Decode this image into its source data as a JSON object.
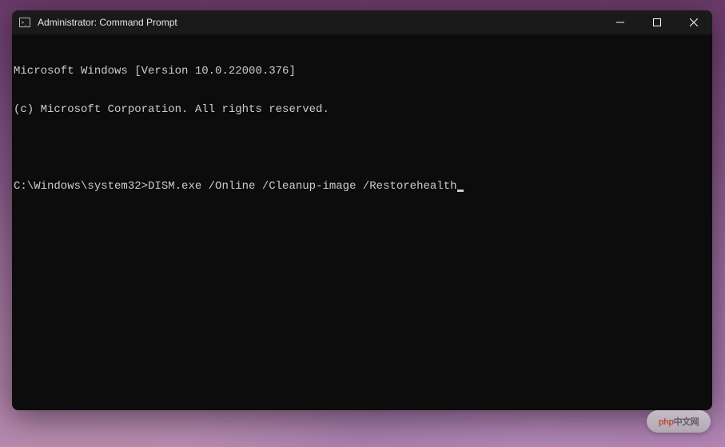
{
  "window": {
    "title": "Administrator: Command Prompt"
  },
  "terminal": {
    "lines": [
      "Microsoft Windows [Version 10.0.22000.376]",
      "(c) Microsoft Corporation. All rights reserved.",
      "",
      ""
    ],
    "prompt": "C:\\Windows\\system32>",
    "command": "DISM.exe /Online /Cleanup-image /Restorehealth"
  },
  "watermark": {
    "brand_prefix": "php",
    "brand_suffix": "中文网"
  }
}
